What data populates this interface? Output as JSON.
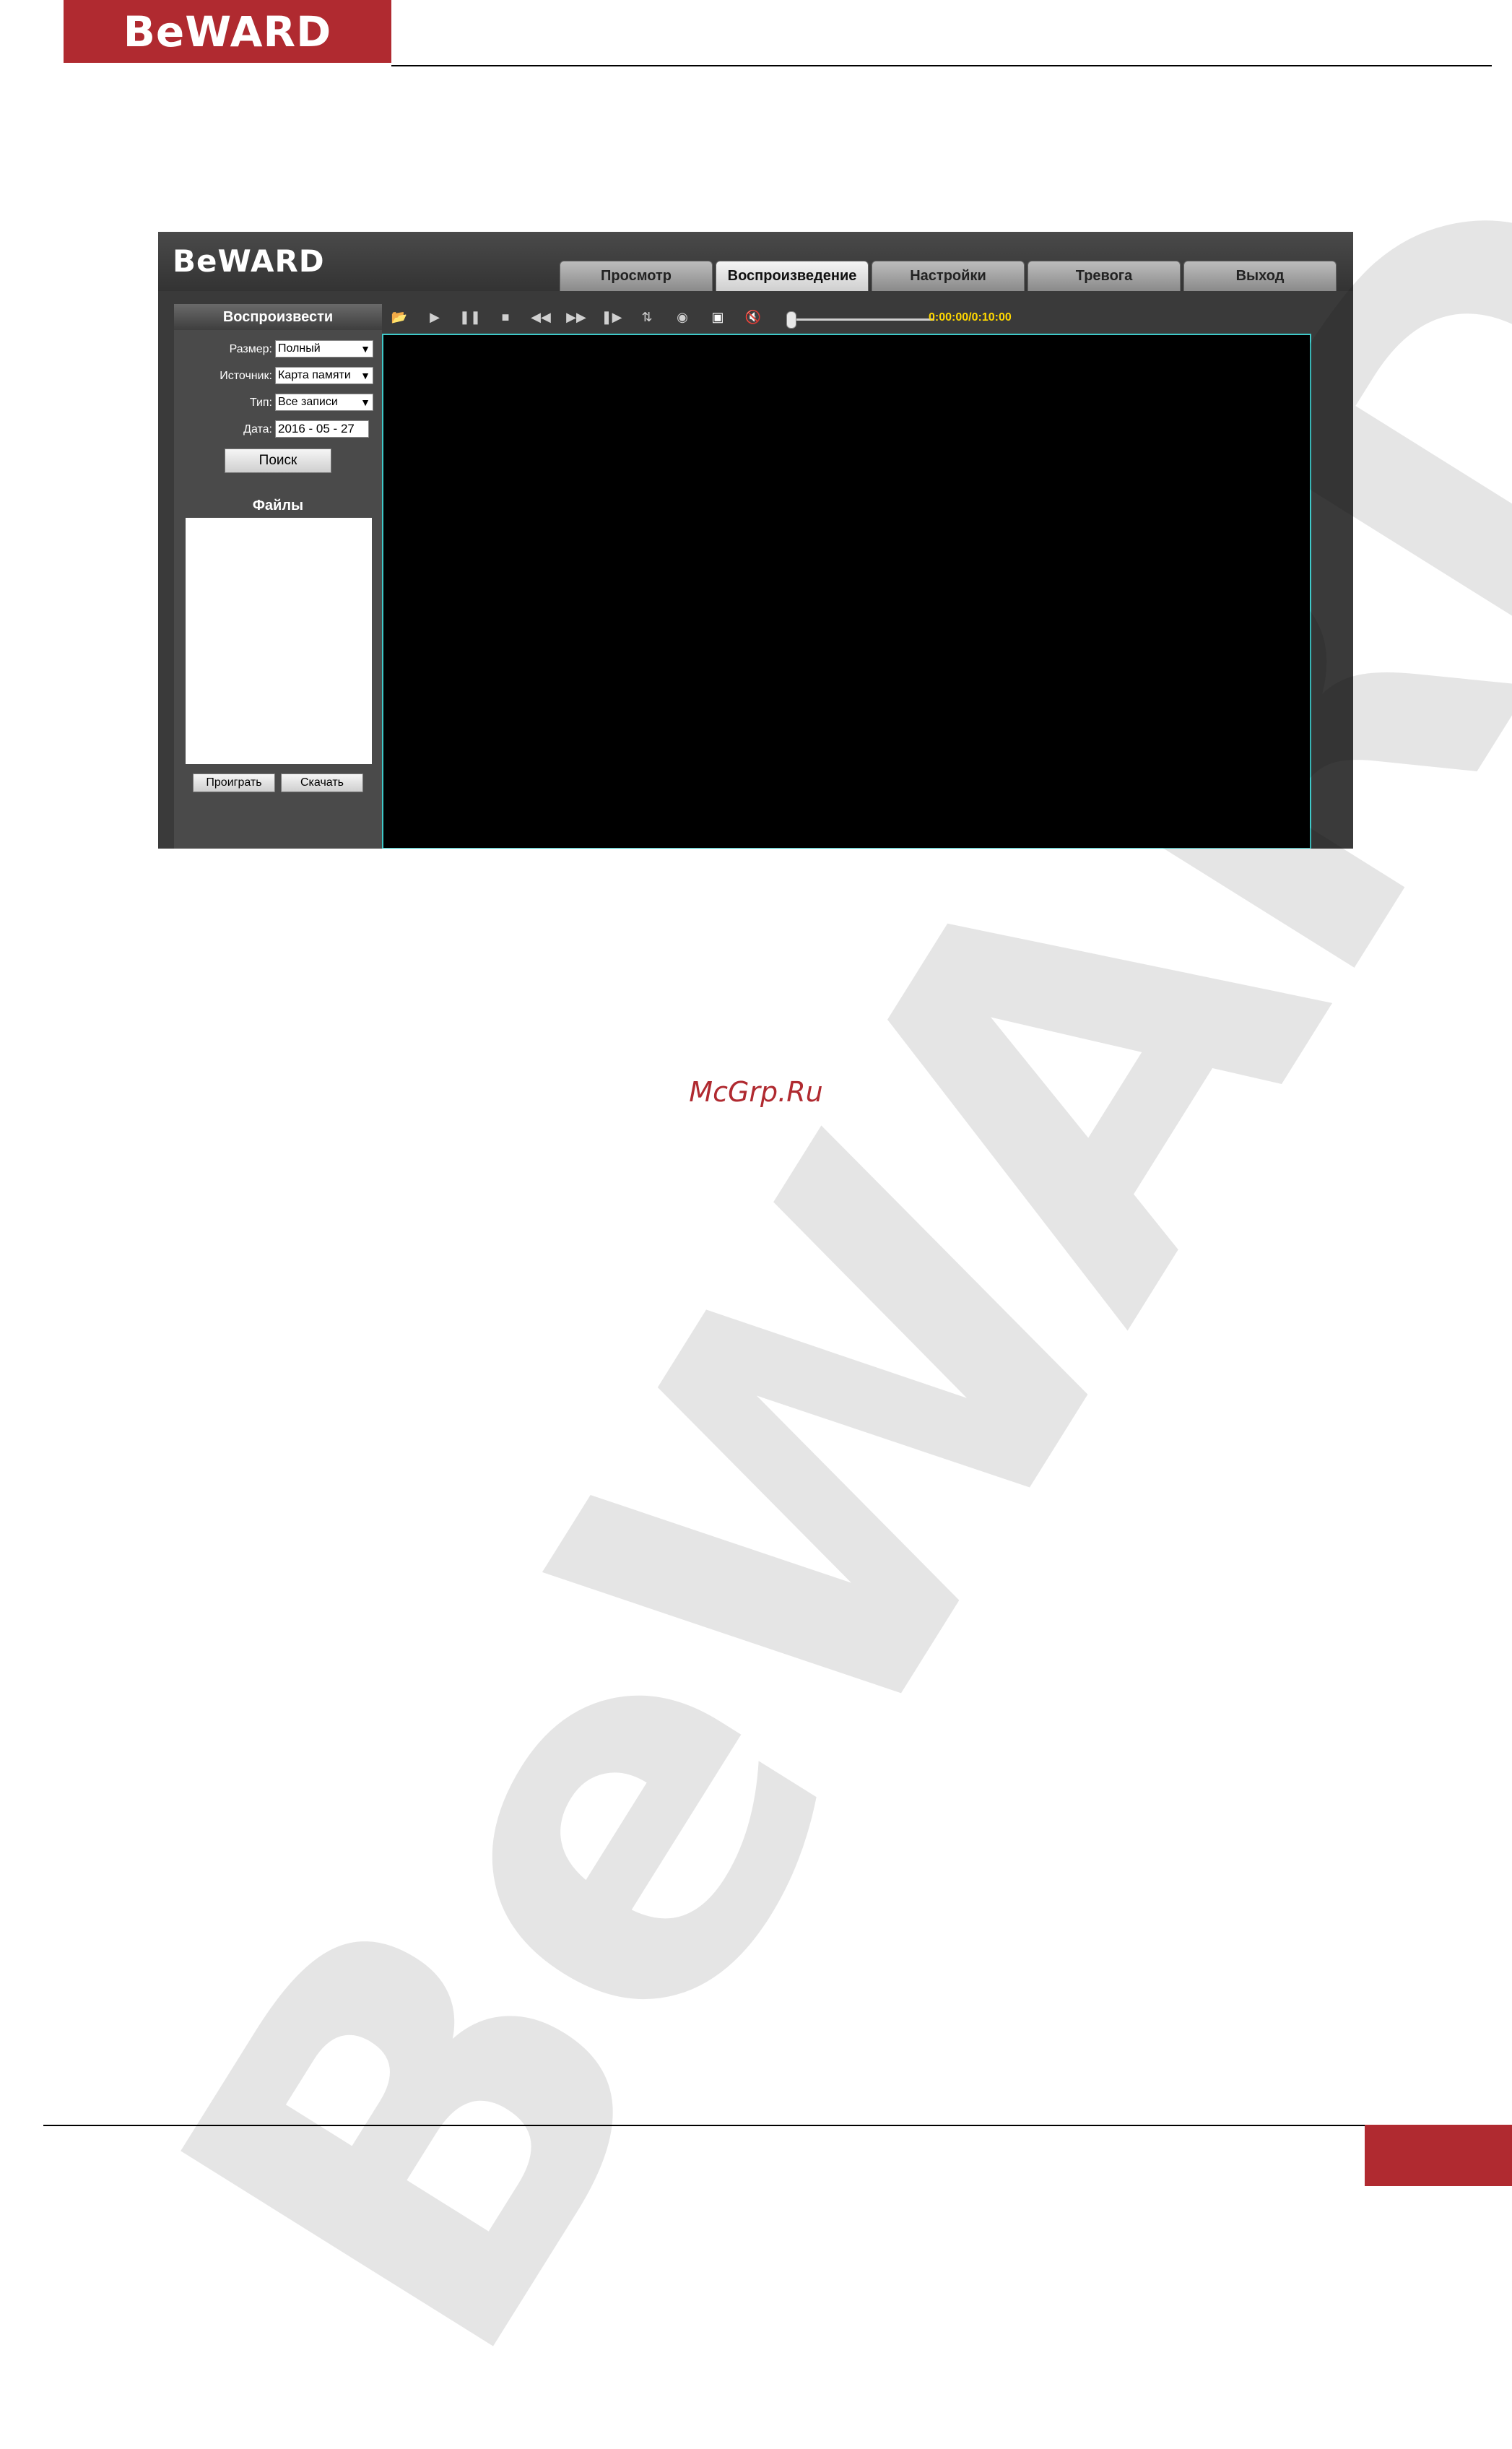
{
  "page": {
    "logo_text": "BeWARD",
    "watermark_text": "BeWARD",
    "site_tag": "McGrp.Ru"
  },
  "app": {
    "logo_text": "BeWARD",
    "tabs": [
      {
        "label": "Просмотр",
        "active": false
      },
      {
        "label": "Воспроизведение",
        "active": true
      },
      {
        "label": "Настройки",
        "active": false
      },
      {
        "label": "Тревога",
        "active": false
      },
      {
        "label": "Выход",
        "active": false
      }
    ],
    "left_panel": {
      "title": "Воспроизвести",
      "size_label": "Размер:",
      "size_value": "Полный",
      "source_label": "Источник:",
      "source_value": "Карта памяти",
      "type_label": "Тип:",
      "type_value": "Все записи",
      "date_label": "Дата:",
      "date_value": "2016 - 05 - 27",
      "search_label": "Поиск",
      "files_title": "Файлы",
      "play_label": "Проиграть",
      "download_label": "Скачать"
    },
    "player": {
      "time_text": "0:00:00/0:10:00",
      "progress": 0.0,
      "toolbar_icons": [
        "open-folder-icon",
        "play-icon",
        "pause-icon",
        "stop-icon",
        "rewind-icon",
        "fast-forward-icon",
        "step-frame-icon",
        "loop-icon",
        "snapshot-icon",
        "fullscreen-icon",
        "mute-icon"
      ]
    }
  },
  "colors": {
    "brand_red": "#b02a30",
    "time_yellow": "#ffd800",
    "video_border": "#3fc9c9"
  }
}
